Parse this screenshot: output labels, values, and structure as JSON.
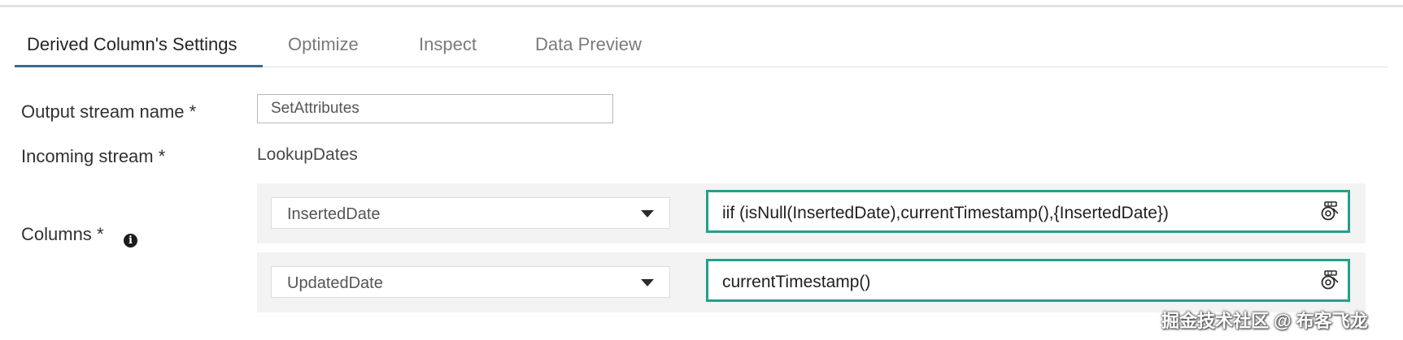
{
  "tabs": [
    {
      "label": "Derived Column's Settings",
      "active": true
    },
    {
      "label": "Optimize",
      "active": false
    },
    {
      "label": "Inspect",
      "active": false
    },
    {
      "label": "Data Preview",
      "active": false
    }
  ],
  "form": {
    "output_stream": {
      "label": "Output stream name",
      "required_marker": "*",
      "value": "SetAttributes"
    },
    "incoming_stream": {
      "label": "Incoming stream",
      "required_marker": "*",
      "value": "LookupDates"
    },
    "columns": {
      "label": "Columns",
      "required_marker": "*",
      "info_icon": "info-icon",
      "rows": [
        {
          "column": "InsertedDate",
          "expression": "iif (isNull(InsertedDate),currentTimestamp(),{InsertedDate})"
        },
        {
          "column": "UpdatedDate",
          "expression": "currentTimestamp()"
        }
      ]
    }
  },
  "watermark": "掘金技术社区 @ 布客飞龙",
  "colors": {
    "accent_underline": "#3b6b8a",
    "expression_border": "#23a08c",
    "row_background": "#f3f3f3"
  }
}
